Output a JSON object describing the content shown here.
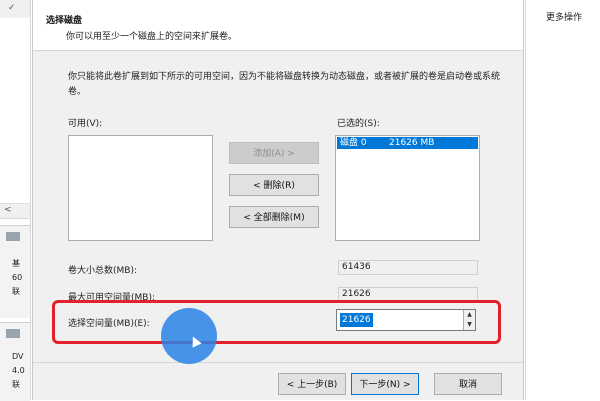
{
  "background_left": {
    "top_tab": "✓",
    "scroll_left": "<",
    "disk1_lines": [
      "基",
      "60",
      "联"
    ],
    "disk2_lines": [
      "DV",
      "4.0",
      "联"
    ]
  },
  "actions_pane": {
    "more_actions": "更多操作"
  },
  "wizard": {
    "title": "选择磁盘",
    "subtitle": "你可以用至少一个磁盘上的空间来扩展卷。",
    "description": "你只能将此卷扩展到如下所示的可用空间，因为不能将磁盘转换为动态磁盘，或者被扩展的卷是启动卷或系统卷。",
    "available_label": "可用(V):",
    "selected_label": "已选的(S):",
    "add_button": "添加(A) >",
    "remove_button": "< 删除(R)",
    "remove_all_button": "< 全部删除(M)",
    "selected_items": [
      {
        "disk": "磁盘 0",
        "size": "21626 MB"
      }
    ],
    "total_volume_size_label": "卷大小总数(MB):",
    "total_volume_size": "61436",
    "max_available_label": "最大可用空间量(MB):",
    "max_available": "21626",
    "select_space_label": "选择空间量(MB)(E):",
    "select_space_value": "21626",
    "back_button": "< 上一步(B)",
    "next_button": "下一步(N) >",
    "cancel_button": "取消"
  },
  "colors": {
    "highlight_box": "#e3212d",
    "cursor_circle": "#2882e6",
    "selection": "#0078d7"
  }
}
